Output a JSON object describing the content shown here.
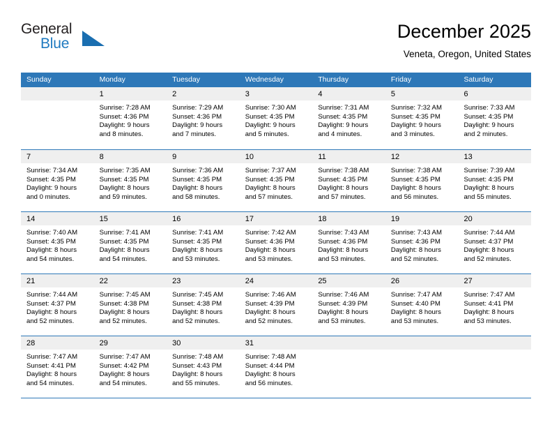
{
  "brand": {
    "general": "General",
    "blue": "Blue",
    "triangle_color": "#1a6eb0"
  },
  "header": {
    "title": "December 2025",
    "subtitle": "Veneta, Oregon, United States"
  },
  "colors": {
    "header_blue": "#2e78b8",
    "day_band_gray": "#efefef",
    "text": "#000000"
  },
  "weekdays": [
    "Sunday",
    "Monday",
    "Tuesday",
    "Wednesday",
    "Thursday",
    "Friday",
    "Saturday"
  ],
  "weeks": [
    [
      {
        "day": "",
        "lines": []
      },
      {
        "day": "1",
        "lines": [
          "Sunrise: 7:28 AM",
          "Sunset: 4:36 PM",
          "Daylight: 9 hours",
          "and 8 minutes."
        ]
      },
      {
        "day": "2",
        "lines": [
          "Sunrise: 7:29 AM",
          "Sunset: 4:36 PM",
          "Daylight: 9 hours",
          "and 7 minutes."
        ]
      },
      {
        "day": "3",
        "lines": [
          "Sunrise: 7:30 AM",
          "Sunset: 4:35 PM",
          "Daylight: 9 hours",
          "and 5 minutes."
        ]
      },
      {
        "day": "4",
        "lines": [
          "Sunrise: 7:31 AM",
          "Sunset: 4:35 PM",
          "Daylight: 9 hours",
          "and 4 minutes."
        ]
      },
      {
        "day": "5",
        "lines": [
          "Sunrise: 7:32 AM",
          "Sunset: 4:35 PM",
          "Daylight: 9 hours",
          "and 3 minutes."
        ]
      },
      {
        "day": "6",
        "lines": [
          "Sunrise: 7:33 AM",
          "Sunset: 4:35 PM",
          "Daylight: 9 hours",
          "and 2 minutes."
        ]
      }
    ],
    [
      {
        "day": "7",
        "lines": [
          "Sunrise: 7:34 AM",
          "Sunset: 4:35 PM",
          "Daylight: 9 hours",
          "and 0 minutes."
        ]
      },
      {
        "day": "8",
        "lines": [
          "Sunrise: 7:35 AM",
          "Sunset: 4:35 PM",
          "Daylight: 8 hours",
          "and 59 minutes."
        ]
      },
      {
        "day": "9",
        "lines": [
          "Sunrise: 7:36 AM",
          "Sunset: 4:35 PM",
          "Daylight: 8 hours",
          "and 58 minutes."
        ]
      },
      {
        "day": "10",
        "lines": [
          "Sunrise: 7:37 AM",
          "Sunset: 4:35 PM",
          "Daylight: 8 hours",
          "and 57 minutes."
        ]
      },
      {
        "day": "11",
        "lines": [
          "Sunrise: 7:38 AM",
          "Sunset: 4:35 PM",
          "Daylight: 8 hours",
          "and 57 minutes."
        ]
      },
      {
        "day": "12",
        "lines": [
          "Sunrise: 7:38 AM",
          "Sunset: 4:35 PM",
          "Daylight: 8 hours",
          "and 56 minutes."
        ]
      },
      {
        "day": "13",
        "lines": [
          "Sunrise: 7:39 AM",
          "Sunset: 4:35 PM",
          "Daylight: 8 hours",
          "and 55 minutes."
        ]
      }
    ],
    [
      {
        "day": "14",
        "lines": [
          "Sunrise: 7:40 AM",
          "Sunset: 4:35 PM",
          "Daylight: 8 hours",
          "and 54 minutes."
        ]
      },
      {
        "day": "15",
        "lines": [
          "Sunrise: 7:41 AM",
          "Sunset: 4:35 PM",
          "Daylight: 8 hours",
          "and 54 minutes."
        ]
      },
      {
        "day": "16",
        "lines": [
          "Sunrise: 7:41 AM",
          "Sunset: 4:35 PM",
          "Daylight: 8 hours",
          "and 53 minutes."
        ]
      },
      {
        "day": "17",
        "lines": [
          "Sunrise: 7:42 AM",
          "Sunset: 4:36 PM",
          "Daylight: 8 hours",
          "and 53 minutes."
        ]
      },
      {
        "day": "18",
        "lines": [
          "Sunrise: 7:43 AM",
          "Sunset: 4:36 PM",
          "Daylight: 8 hours",
          "and 53 minutes."
        ]
      },
      {
        "day": "19",
        "lines": [
          "Sunrise: 7:43 AM",
          "Sunset: 4:36 PM",
          "Daylight: 8 hours",
          "and 52 minutes."
        ]
      },
      {
        "day": "20",
        "lines": [
          "Sunrise: 7:44 AM",
          "Sunset: 4:37 PM",
          "Daylight: 8 hours",
          "and 52 minutes."
        ]
      }
    ],
    [
      {
        "day": "21",
        "lines": [
          "Sunrise: 7:44 AM",
          "Sunset: 4:37 PM",
          "Daylight: 8 hours",
          "and 52 minutes."
        ]
      },
      {
        "day": "22",
        "lines": [
          "Sunrise: 7:45 AM",
          "Sunset: 4:38 PM",
          "Daylight: 8 hours",
          "and 52 minutes."
        ]
      },
      {
        "day": "23",
        "lines": [
          "Sunrise: 7:45 AM",
          "Sunset: 4:38 PM",
          "Daylight: 8 hours",
          "and 52 minutes."
        ]
      },
      {
        "day": "24",
        "lines": [
          "Sunrise: 7:46 AM",
          "Sunset: 4:39 PM",
          "Daylight: 8 hours",
          "and 52 minutes."
        ]
      },
      {
        "day": "25",
        "lines": [
          "Sunrise: 7:46 AM",
          "Sunset: 4:39 PM",
          "Daylight: 8 hours",
          "and 53 minutes."
        ]
      },
      {
        "day": "26",
        "lines": [
          "Sunrise: 7:47 AM",
          "Sunset: 4:40 PM",
          "Daylight: 8 hours",
          "and 53 minutes."
        ]
      },
      {
        "day": "27",
        "lines": [
          "Sunrise: 7:47 AM",
          "Sunset: 4:41 PM",
          "Daylight: 8 hours",
          "and 53 minutes."
        ]
      }
    ],
    [
      {
        "day": "28",
        "lines": [
          "Sunrise: 7:47 AM",
          "Sunset: 4:41 PM",
          "Daylight: 8 hours",
          "and 54 minutes."
        ]
      },
      {
        "day": "29",
        "lines": [
          "Sunrise: 7:47 AM",
          "Sunset: 4:42 PM",
          "Daylight: 8 hours",
          "and 54 minutes."
        ]
      },
      {
        "day": "30",
        "lines": [
          "Sunrise: 7:48 AM",
          "Sunset: 4:43 PM",
          "Daylight: 8 hours",
          "and 55 minutes."
        ]
      },
      {
        "day": "31",
        "lines": [
          "Sunrise: 7:48 AM",
          "Sunset: 4:44 PM",
          "Daylight: 8 hours",
          "and 56 minutes."
        ]
      },
      {
        "day": "",
        "lines": []
      },
      {
        "day": "",
        "lines": []
      },
      {
        "day": "",
        "lines": []
      }
    ]
  ]
}
